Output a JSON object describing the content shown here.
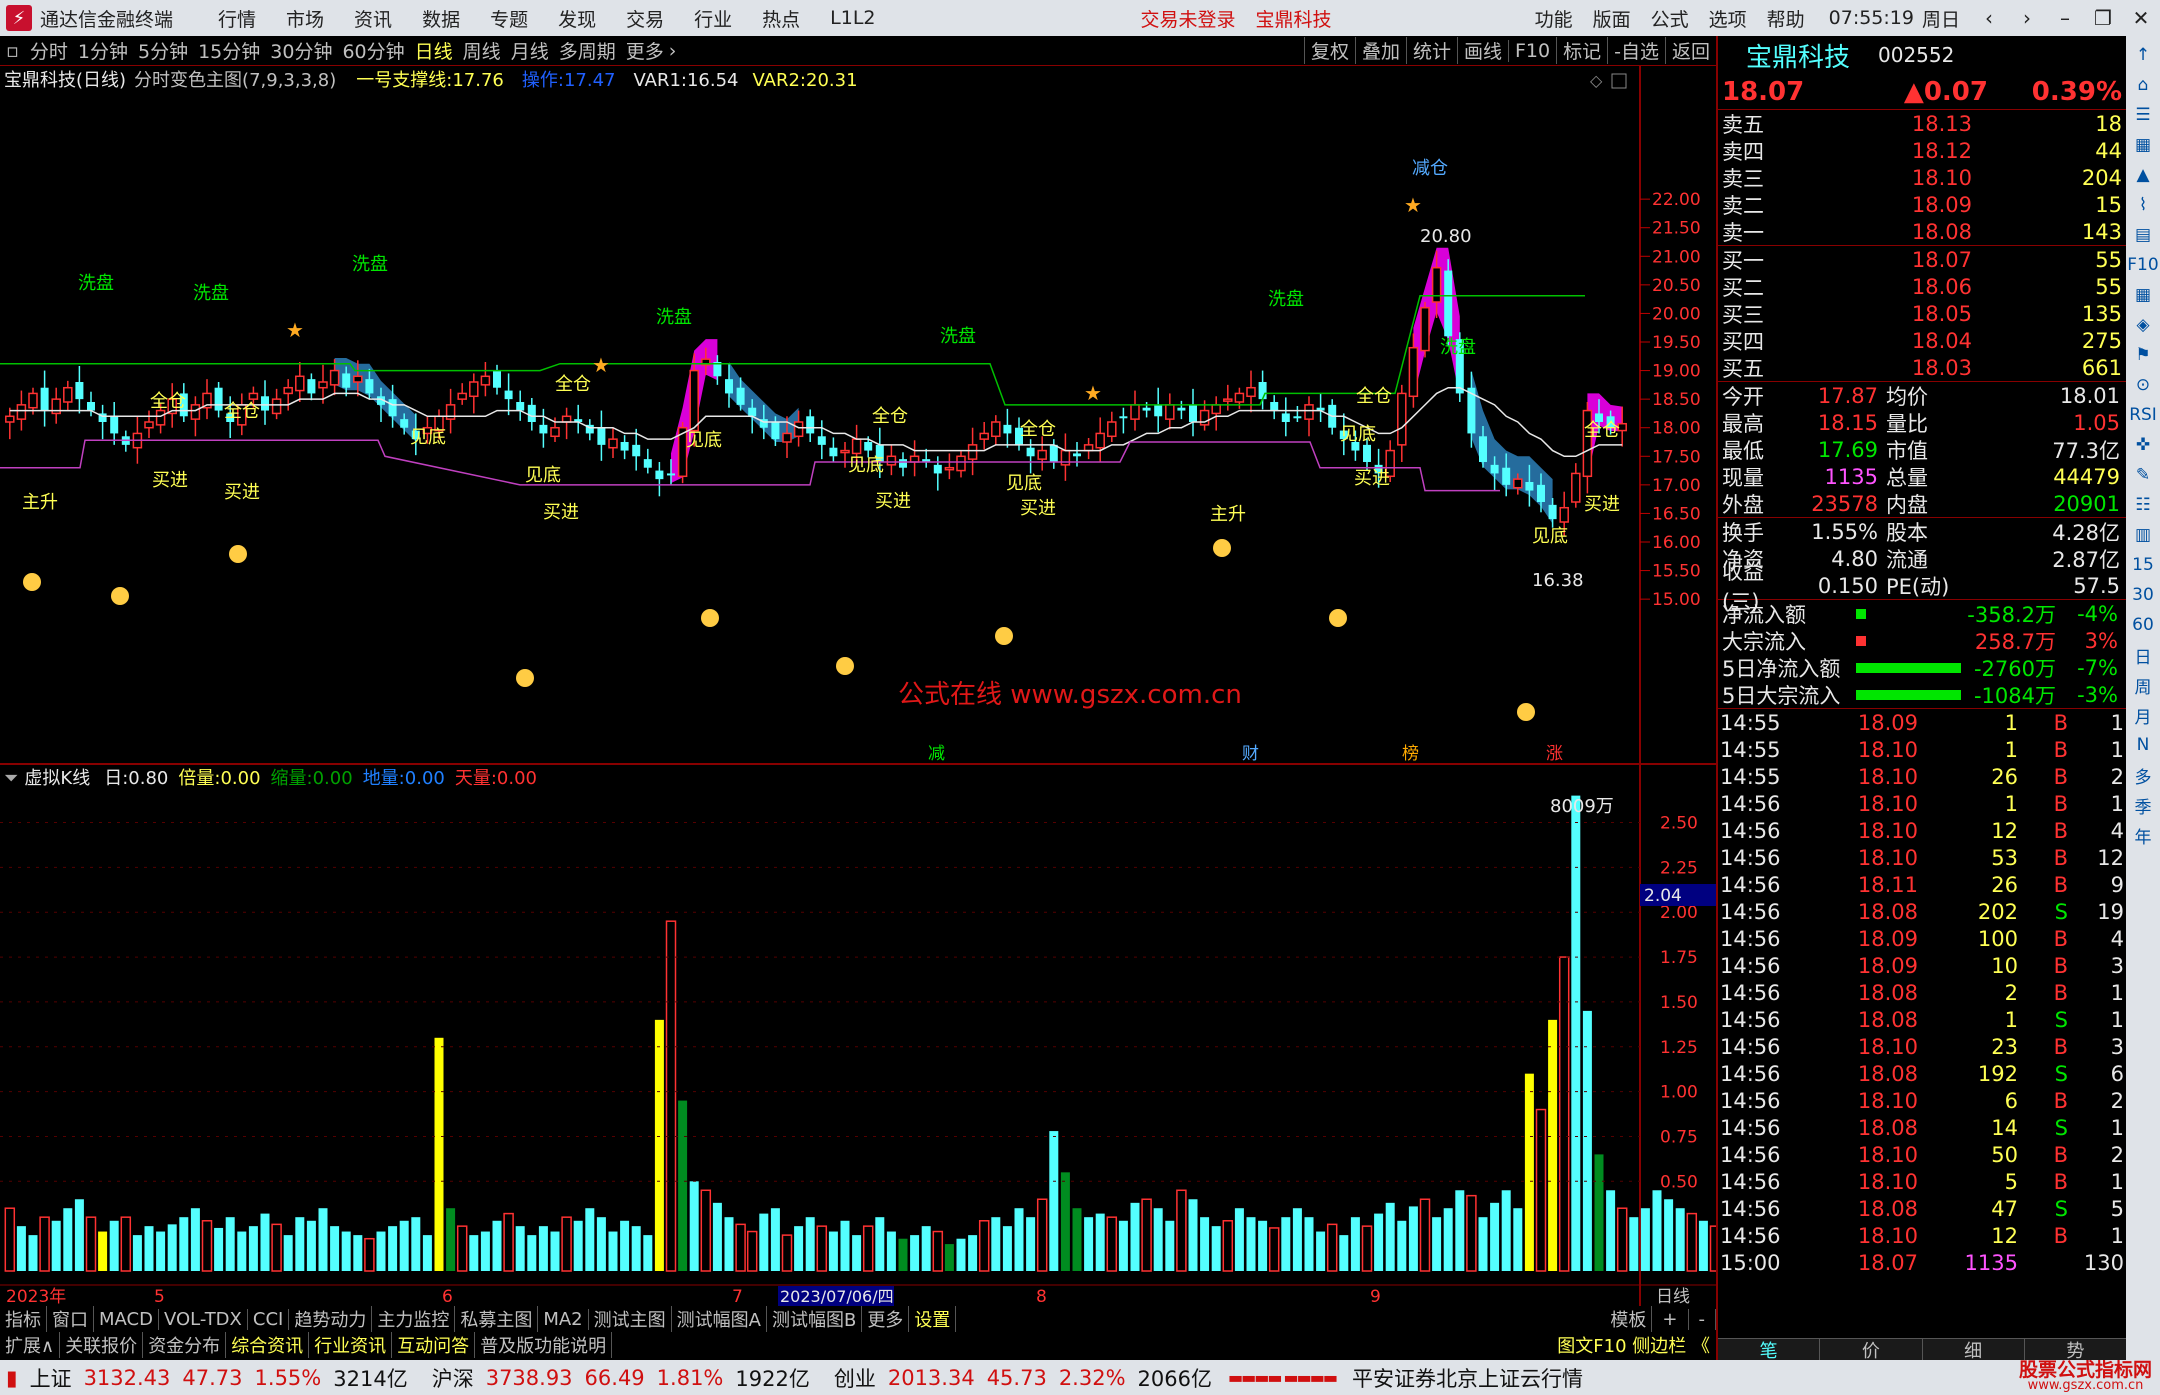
{
  "titlebar": {
    "app_name": "通达信金融终端",
    "menus": [
      "行情",
      "市场",
      "资讯",
      "数据",
      "专题",
      "发现",
      "交易",
      "行业",
      "热点",
      "L1L2"
    ],
    "trade_status": "交易未登录",
    "current_stock": "宝鼎科技",
    "right_menus": [
      "功能",
      "版面",
      "公式",
      "选项",
      "帮助"
    ],
    "clock": "07:55:19",
    "weekday": "周日"
  },
  "periods": [
    "分时",
    "1分钟",
    "5分钟",
    "15分钟",
    "30分钟",
    "60分钟",
    "日线",
    "周线",
    "月线",
    "多周期",
    "更多"
  ],
  "active_period": "日线",
  "tools": [
    "复权",
    "叠加",
    "统计",
    "画线",
    "F10",
    "标记",
    "-自选",
    "返回"
  ],
  "main_chart": {
    "stock_label": "宝鼎科技(日线)",
    "formula_name": "分时变色主图(7,9,3,3,8)",
    "support_label": "一号支撑线:",
    "support_value": "17.76",
    "op_label": "操作:",
    "op_value": "17.47",
    "var1": "VAR1:",
    "var1_value": "16.54",
    "var2": "VAR2:",
    "var2_value": "20.31",
    "price_axis": [
      "22.00",
      "21.50",
      "21.00",
      "20.50",
      "20.00",
      "19.50",
      "19.00",
      "18.50",
      "18.00",
      "17.50",
      "17.00",
      "16.50",
      "16.00",
      "15.50",
      "15.00"
    ],
    "high_mark": "20.80",
    "low_mark": "16.38",
    "watermark": "公式在线  www.gszx.com.cn",
    "labels": [
      {
        "t": "洗盘",
        "c": "green"
      },
      {
        "t": "洗盘",
        "c": "green"
      },
      {
        "t": "洗盘",
        "c": "green"
      },
      {
        "t": "洗盘",
        "c": "green"
      },
      {
        "t": "洗盘",
        "c": "green"
      },
      {
        "t": "洗盘",
        "c": "green"
      },
      {
        "t": "洗盘",
        "c": "green"
      },
      {
        "t": "减仓",
        "c": "blue"
      },
      {
        "t": "全仓",
        "c": "yellow"
      },
      {
        "t": "全仓",
        "c": "yellow"
      },
      {
        "t": "全仓",
        "c": "yellow"
      },
      {
        "t": "全仓",
        "c": "yellow"
      },
      {
        "t": "全仓",
        "c": "yellow"
      },
      {
        "t": "全仓",
        "c": "yellow"
      },
      {
        "t": "全仓",
        "c": "yellow"
      },
      {
        "t": "见底",
        "c": "yellow"
      },
      {
        "t": "见底",
        "c": "yellow"
      },
      {
        "t": "见底",
        "c": "yellow"
      },
      {
        "t": "见底",
        "c": "yellow"
      },
      {
        "t": "见底",
        "c": "yellow"
      },
      {
        "t": "见底",
        "c": "yellow"
      },
      {
        "t": "见底",
        "c": "yellow"
      },
      {
        "t": "买进",
        "c": "yellow"
      },
      {
        "t": "买进",
        "c": "yellow"
      },
      {
        "t": "买进",
        "c": "yellow"
      },
      {
        "t": "买进",
        "c": "yellow"
      },
      {
        "t": "买进",
        "c": "yellow"
      },
      {
        "t": "买进",
        "c": "yellow"
      },
      {
        "t": "买进",
        "c": "yellow"
      },
      {
        "t": "主升",
        "c": "yellow"
      },
      {
        "t": "主升",
        "c": "yellow"
      }
    ],
    "event_tags": [
      "减",
      "财",
      "榜",
      "涨"
    ]
  },
  "vol_chart": {
    "name": "虚拟K线",
    "day_label": "日:",
    "day_value": "0.80",
    "bei_label": "倍量:",
    "bei_value": "0.00",
    "suo_label": "缩量:",
    "suo_value": "0.00",
    "di_label": "地量:",
    "di_value": "0.00",
    "tian_label": "天量:",
    "tian_value": "0.00",
    "max_label": "8009万",
    "axis": [
      "2.50",
      "2.25",
      "2.00",
      "1.75",
      "1.50",
      "1.25",
      "1.00",
      "0.75",
      "0.50"
    ],
    "cursor_value": "2.04",
    "volumes": [
      0.35,
      0.25,
      0.2,
      0.3,
      0.28,
      0.35,
      0.4,
      0.3,
      0.22,
      0.28,
      0.3,
      0.2,
      0.25,
      0.22,
      0.26,
      0.3,
      0.35,
      0.28,
      0.24,
      0.3,
      0.22,
      0.25,
      0.32,
      0.26,
      0.2,
      0.3,
      0.28,
      0.35,
      0.25,
      0.22,
      0.2,
      0.18,
      0.22,
      0.25,
      0.28,
      0.3,
      0.2,
      1.3,
      0.35,
      0.25,
      0.2,
      0.22,
      0.28,
      0.32,
      0.25,
      0.2,
      0.25,
      0.22,
      0.3,
      0.28,
      0.35,
      0.3,
      0.22,
      0.28,
      0.25,
      0.2,
      1.4,
      1.95,
      0.95,
      0.5,
      0.45,
      0.38,
      0.3,
      0.26,
      0.22,
      0.32,
      0.35,
      0.2,
      0.25,
      0.3,
      0.25,
      0.22,
      0.28,
      0.2,
      0.25,
      0.3,
      0.22,
      0.18,
      0.2,
      0.25,
      0.22,
      0.15,
      0.18,
      0.2,
      0.28,
      0.3,
      0.25,
      0.35,
      0.3,
      0.4,
      0.78,
      0.55,
      0.35,
      0.3,
      0.32,
      0.3,
      0.28,
      0.38,
      0.4,
      0.35,
      0.28,
      0.45,
      0.4,
      0.3,
      0.25,
      0.28,
      0.35,
      0.3,
      0.28,
      0.24,
      0.3,
      0.35,
      0.3,
      0.22,
      0.26,
      0.2,
      0.3,
      0.25,
      0.32,
      0.38,
      0.28,
      0.36,
      0.4,
      0.3,
      0.35,
      0.45,
      0.42,
      0.3,
      0.38,
      0.45,
      0.35,
      1.1,
      0.9,
      1.4,
      1.75,
      2.65,
      1.45,
      0.65,
      0.45,
      0.35,
      0.3,
      0.35,
      0.45,
      0.4,
      0.35,
      0.32,
      0.28,
      0.25,
      0.2,
      1.5,
      1.42,
      0.8
    ],
    "vol_kinds": [
      "r",
      "c",
      "c",
      "r",
      "c",
      "c",
      "c",
      "r",
      "y",
      "c",
      "r",
      "c",
      "c",
      "c",
      "c",
      "c",
      "c",
      "r",
      "c",
      "c",
      "c",
      "c",
      "c",
      "r",
      "c",
      "c",
      "c",
      "c",
      "c",
      "c",
      "c",
      "r",
      "c",
      "c",
      "c",
      "c",
      "c",
      "y",
      "g",
      "r",
      "c",
      "c",
      "c",
      "r",
      "c",
      "c",
      "c",
      "c",
      "r",
      "c",
      "c",
      "c",
      "c",
      "c",
      "c",
      "c",
      "y",
      "r",
      "g",
      "c",
      "r",
      "c",
      "c",
      "r",
      "r",
      "c",
      "c",
      "r",
      "c",
      "c",
      "r",
      "c",
      "c",
      "c",
      "r",
      "c",
      "c",
      "g",
      "c",
      "c",
      "r",
      "g",
      "c",
      "c",
      "r",
      "c",
      "c",
      "c",
      "c",
      "r",
      "c",
      "g",
      "g",
      "c",
      "c",
      "r",
      "c",
      "c",
      "r",
      "c",
      "c",
      "r",
      "c",
      "c",
      "c",
      "r",
      "c",
      "c",
      "c",
      "r",
      "c",
      "c",
      "c",
      "c",
      "r",
      "c",
      "c",
      "r",
      "c",
      "c",
      "c",
      "c",
      "r",
      "c",
      "c",
      "c",
      "r",
      "c",
      "c",
      "c",
      "c",
      "y",
      "r",
      "y",
      "r",
      "c",
      "c",
      "g",
      "c",
      "r",
      "c",
      "c",
      "c",
      "c",
      "c",
      "r",
      "c",
      "r",
      "c",
      "y",
      "c",
      "r"
    ]
  },
  "x_axis": {
    "year": "2023年",
    "months": [
      "5",
      "6",
      "7",
      "8",
      "9"
    ],
    "cursor_date": "2023/07/06/四",
    "period_label": "日线"
  },
  "bottom_tabs": [
    "指标",
    "窗口",
    "MACD",
    "VOL-TDX",
    "CCI",
    "趋势动力",
    "主力监控",
    "私募主图",
    "MA2",
    "测试主图",
    "测试幅图A",
    "测试幅图B",
    "更多",
    "设置"
  ],
  "bottom_right": [
    "模板",
    "+",
    "-"
  ],
  "bottom_tabs2": [
    "扩展∧",
    "关联报价",
    "资金分布",
    "综合资讯",
    "行业资讯",
    "互动问答",
    "普及版功能说明"
  ],
  "bottom_tabs2_right": "图文F10 侧边栏 《",
  "quote_tabs": [
    "笔",
    "价",
    "细",
    "势"
  ],
  "quote": {
    "name": "宝鼎科技",
    "code": "002552",
    "price": "18.07",
    "change": "▲0.07",
    "pct": "0.39%",
    "asks": [
      [
        "卖五",
        "18.13",
        "18"
      ],
      [
        "卖四",
        "18.12",
        "44"
      ],
      [
        "卖三",
        "18.10",
        "204"
      ],
      [
        "卖二",
        "18.09",
        "15"
      ],
      [
        "卖一",
        "18.08",
        "143"
      ]
    ],
    "bids": [
      [
        "买一",
        "18.07",
        "55"
      ],
      [
        "买二",
        "18.06",
        "55"
      ],
      [
        "买三",
        "18.05",
        "135"
      ],
      [
        "买四",
        "18.04",
        "275"
      ],
      [
        "买五",
        "18.03",
        "661"
      ]
    ],
    "stats": [
      [
        "今开",
        "17.87",
        "均价",
        "18.01"
      ],
      [
        "最高",
        "18.15",
        "量比",
        "1.05"
      ],
      [
        "最低",
        "17.69",
        "市值",
        "77.3亿"
      ],
      [
        "现量",
        "1135",
        "总量",
        "44479"
      ],
      [
        "外盘",
        "23578",
        "内盘",
        "20901"
      ]
    ],
    "stats2": [
      [
        "换手",
        "1.55%",
        "股本",
        "4.28亿"
      ],
      [
        "净资",
        "4.80",
        "流通",
        "2.87亿"
      ],
      [
        "收益(三)",
        "0.150",
        "PE(动)",
        "57.5"
      ]
    ],
    "flows": [
      [
        "净流入额",
        "-358.2万",
        "-4%"
      ],
      [
        "大宗流入",
        "258.7万",
        "3%"
      ],
      [
        "5日净流入额",
        "-2760万",
        "-7%"
      ],
      [
        "5日大宗流入",
        "-1084万",
        "-3%"
      ]
    ],
    "ticks": [
      [
        "14:55",
        "18.09",
        "1",
        "B",
        "1"
      ],
      [
        "14:55",
        "18.10",
        "1",
        "B",
        "1"
      ],
      [
        "14:55",
        "18.10",
        "26",
        "B",
        "2"
      ],
      [
        "14:56",
        "18.10",
        "1",
        "B",
        "1"
      ],
      [
        "14:56",
        "18.10",
        "12",
        "B",
        "4"
      ],
      [
        "14:56",
        "18.10",
        "53",
        "B",
        "12"
      ],
      [
        "14:56",
        "18.11",
        "26",
        "B",
        "9"
      ],
      [
        "14:56",
        "18.08",
        "202",
        "S",
        "19"
      ],
      [
        "14:56",
        "18.09",
        "100",
        "B",
        "4"
      ],
      [
        "14:56",
        "18.09",
        "10",
        "B",
        "3"
      ],
      [
        "14:56",
        "18.08",
        "2",
        "B",
        "1"
      ],
      [
        "14:56",
        "18.08",
        "1",
        "S",
        "1"
      ],
      [
        "14:56",
        "18.10",
        "23",
        "B",
        "3"
      ],
      [
        "14:56",
        "18.08",
        "192",
        "S",
        "6"
      ],
      [
        "14:56",
        "18.10",
        "6",
        "B",
        "2"
      ],
      [
        "14:56",
        "18.08",
        "14",
        "S",
        "1"
      ],
      [
        "14:56",
        "18.10",
        "50",
        "B",
        "2"
      ],
      [
        "14:56",
        "18.10",
        "5",
        "B",
        "1"
      ],
      [
        "14:56",
        "18.08",
        "47",
        "S",
        "5"
      ],
      [
        "14:56",
        "18.10",
        "12",
        "B",
        "1"
      ],
      [
        "15:00",
        "18.07",
        "1135",
        "",
        "130"
      ]
    ]
  },
  "side_icons": [
    "↑",
    "⌂",
    "☰",
    "▦",
    "▲",
    "⌇",
    "▤",
    "F10",
    "▦",
    "◈",
    "⚑",
    "⊙",
    "RSI",
    "✜",
    "✎",
    "☷",
    "▥",
    "15",
    "30",
    "60",
    "日",
    "周",
    "月",
    "N",
    "多",
    "季",
    "年"
  ],
  "status": {
    "indices": [
      [
        "上证",
        "3132.43",
        "47.73",
        "1.55%",
        "3214亿"
      ],
      [
        "沪深",
        "3738.93",
        "66.49",
        "1.81%",
        "1922亿"
      ],
      [
        "创业",
        "2013.34",
        "45.73",
        "2.32%",
        "2066亿"
      ]
    ],
    "broker": "平安证券北京上证云行情",
    "logo_text": "股票公式指标网",
    "logo_url": "www.gszx.com.cn"
  },
  "colors": {
    "up": "#ff3232",
    "down": "#54ffff",
    "magenta": "#ff00ff",
    "blue_band": "#2c7fb8",
    "support": "#00c000",
    "mauve": "#c040c0"
  },
  "chart_data": {
    "type": "candlestick",
    "ylim": [
      14.6,
      22.3
    ],
    "closes": [
      18.2,
      18.4,
      18.6,
      18.3,
      18.5,
      18.7,
      18.5,
      18.3,
      18.1,
      17.9,
      17.7,
      17.9,
      18.1,
      18.3,
      18.5,
      18.2,
      18.4,
      18.6,
      18.3,
      18.1,
      18.4,
      18.6,
      18.3,
      18.5,
      18.7,
      18.9,
      18.6,
      18.8,
      19.0,
      18.7,
      18.9,
      18.6,
      18.4,
      18.2,
      18.0,
      17.8,
      18.0,
      18.2,
      18.4,
      18.6,
      18.8,
      18.9,
      18.7,
      18.5,
      18.3,
      18.1,
      17.9,
      18.0,
      18.2,
      18.1,
      17.9,
      17.7,
      17.8,
      17.6,
      17.5,
      17.3,
      17.1,
      17.2,
      18.0,
      19.0,
      19.2,
      18.9,
      18.6,
      18.4,
      18.2,
      18.0,
      17.8,
      17.9,
      18.1,
      17.9,
      17.7,
      17.5,
      17.6,
      17.8,
      17.6,
      17.4,
      17.5,
      17.3,
      17.5,
      17.4,
      17.2,
      17.3,
      17.5,
      17.7,
      17.9,
      18.1,
      17.9,
      17.7,
      17.5,
      17.6,
      17.4,
      17.6,
      17.5,
      17.7,
      17.9,
      18.1,
      18.2,
      18.4,
      18.3,
      18.2,
      18.4,
      18.3,
      18.1,
      18.3,
      18.4,
      18.5,
      18.6,
      18.7,
      18.5,
      18.3,
      18.1,
      18.2,
      18.4,
      18.3,
      18.0,
      17.8,
      17.6,
      17.4,
      17.2,
      17.6,
      18.6,
      19.4,
      20.1,
      20.8,
      19.6,
      18.6,
      17.9,
      17.4,
      17.2,
      17.0,
      17.1,
      16.9,
      16.7,
      16.4,
      16.6,
      17.2,
      18.3,
      18.1,
      18.0,
      18.07
    ],
    "avg_line": [
      18.3,
      18.3,
      18.3,
      18.3,
      18.3,
      18.3,
      18.3,
      18.3,
      18.2,
      18.2,
      18.2,
      18.2,
      18.2,
      18.2,
      18.3,
      18.3,
      18.3,
      18.4,
      18.4,
      18.4,
      18.4,
      18.4,
      18.4,
      18.4,
      18.4,
      18.5,
      18.5,
      18.5,
      18.6,
      18.6,
      18.6,
      18.5,
      18.5,
      18.4,
      18.4,
      18.3,
      18.2,
      18.2,
      18.2,
      18.2,
      18.2,
      18.2,
      18.3,
      18.3,
      18.3,
      18.2,
      18.2,
      18.1,
      18.1,
      18.1,
      18.0,
      18.0,
      18.0,
      17.9,
      17.9,
      17.8,
      17.8,
      17.8,
      17.9,
      18.0,
      18.2,
      18.2,
      18.2,
      18.2,
      18.2,
      18.1,
      18.1,
      18.1,
      18.0,
      18.0,
      18.0,
      17.9,
      17.9,
      17.8,
      17.8,
      17.7,
      17.7,
      17.7,
      17.6,
      17.6,
      17.6,
      17.6,
      17.6,
      17.6,
      17.6,
      17.7,
      17.7,
      17.7,
      17.7,
      17.7,
      17.7,
      17.6,
      17.6,
      17.6,
      17.6,
      17.7,
      17.7,
      17.8,
      17.9,
      17.9,
      18.0,
      18.0,
      18.1,
      18.1,
      18.2,
      18.2,
      18.3,
      18.3,
      18.3,
      18.3,
      18.3,
      18.3,
      18.3,
      18.3,
      18.2,
      18.2,
      18.1,
      18.0,
      17.9,
      17.9,
      18.0,
      18.2,
      18.4,
      18.6,
      18.7,
      18.7,
      18.6,
      18.5,
      18.4,
      18.2,
      18.1,
      17.9,
      17.8,
      17.6,
      17.5,
      17.5,
      17.6,
      17.7,
      17.7,
      17.7
    ]
  }
}
